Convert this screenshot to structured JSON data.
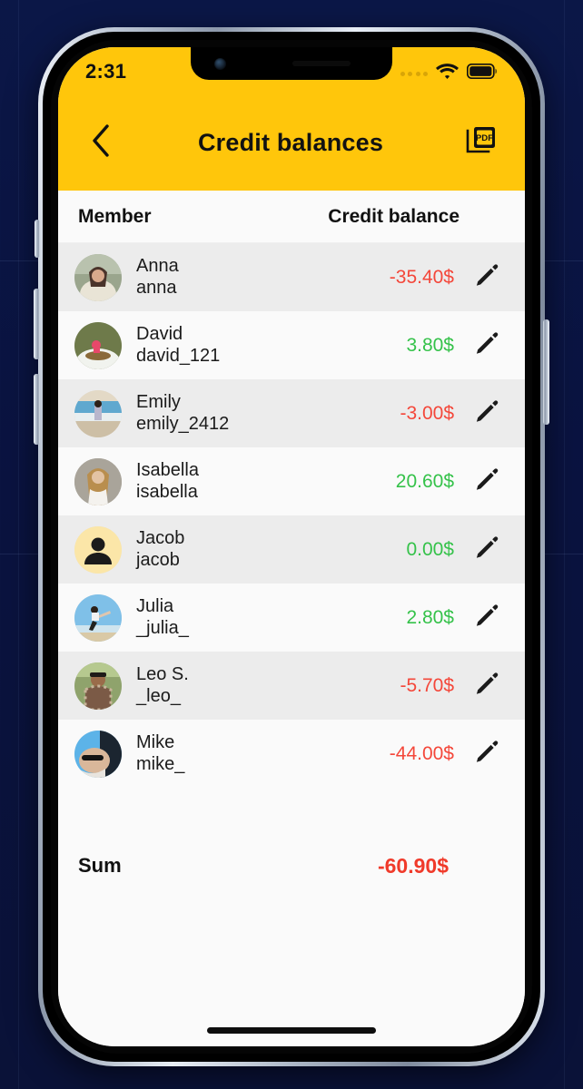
{
  "status_bar": {
    "time": "2:31",
    "cellular_icon": "cellular-dots-icon",
    "wifi_icon": "wifi-icon",
    "battery_icon": "battery-full-icon"
  },
  "app_bar": {
    "back_icon": "chevron-left-icon",
    "title": "Credit balances",
    "export_icon": "pdf-export-icon",
    "export_label": "PDF",
    "background_color": "#FFC60B"
  },
  "table": {
    "headers": {
      "member": "Member",
      "balance": "Credit balance"
    },
    "rows": [
      {
        "name": "Anna",
        "handle": "anna",
        "amount": "-35.40$",
        "sign": "neg",
        "avatar": "photo-anna",
        "edit_icon": "pencil-icon"
      },
      {
        "name": "David",
        "handle": "david_121",
        "amount": "3.80$",
        "sign": "pos",
        "avatar": "photo-david",
        "edit_icon": "pencil-icon"
      },
      {
        "name": "Emily",
        "handle": "emily_2412",
        "amount": "-3.00$",
        "sign": "neg",
        "avatar": "photo-emily",
        "edit_icon": "pencil-icon"
      },
      {
        "name": "Isabella",
        "handle": "isabella",
        "amount": "20.60$",
        "sign": "pos",
        "avatar": "photo-isabella",
        "edit_icon": "pencil-icon"
      },
      {
        "name": "Jacob",
        "handle": "jacob",
        "amount": "0.00$",
        "sign": "pos",
        "avatar": "placeholder-person",
        "edit_icon": "pencil-icon"
      },
      {
        "name": "Julia",
        "handle": "_julia_",
        "amount": "2.80$",
        "sign": "pos",
        "avatar": "photo-julia",
        "edit_icon": "pencil-icon"
      },
      {
        "name": "Leo S.",
        "handle": "_leo_",
        "amount": "-5.70$",
        "sign": "neg",
        "avatar": "photo-leo",
        "edit_icon": "pencil-icon"
      },
      {
        "name": "Mike",
        "handle": "mike_",
        "amount": "-44.00$",
        "sign": "neg",
        "avatar": "photo-mike",
        "edit_icon": "pencil-icon"
      }
    ],
    "sum": {
      "label": "Sum",
      "value": "-60.90$",
      "sign": "neg"
    }
  },
  "colors": {
    "accent": "#FFC60B",
    "negative": "#F4473A",
    "positive": "#35C24A",
    "sum_negative": "#F03A2A",
    "row_odd": "#ECECEC",
    "row_even": "#FAFAFA",
    "backdrop": "#0A1340"
  },
  "home_indicator": "home-indicator"
}
